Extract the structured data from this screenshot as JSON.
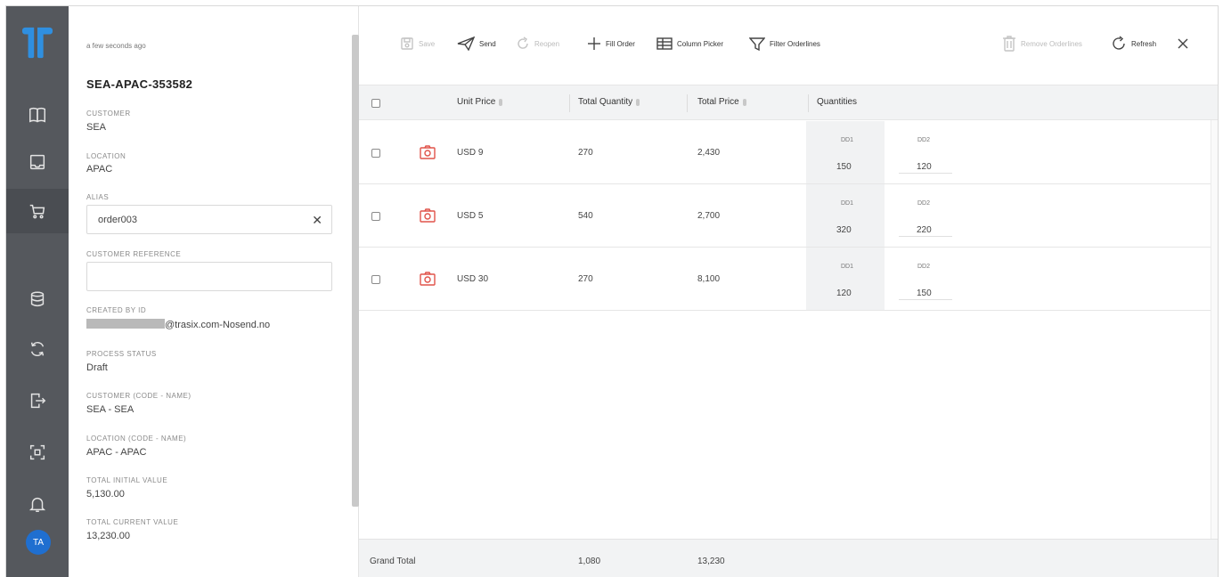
{
  "sidebar": {
    "avatar_initials": "TA",
    "nav": [
      "book-icon",
      "inbox-icon",
      "cart-icon",
      "database-icon",
      "sync-icon",
      "export-icon",
      "scan-icon",
      "bell-icon"
    ],
    "accent": "#1f6fd0"
  },
  "details": {
    "timestamp": "a few seconds ago",
    "order_title": "SEA-APAC-353582",
    "customer_label": "CUSTOMER",
    "customer_value": "SEA",
    "location_label": "LOCATION",
    "location_value": "APAC",
    "alias_label": "ALIAS",
    "alias_value": "order003",
    "customer_reference_label": "CUSTOMER REFERENCE",
    "customer_reference_value": "",
    "created_by_label": "CREATED BY ID",
    "created_by_value": "@trasix.com-Nosend.no",
    "process_status_label": "PROCESS STATUS",
    "process_status_value": "Draft",
    "customer_code_label": "CUSTOMER (CODE - NAME)",
    "customer_code_value": "SEA - SEA",
    "location_code_label": "LOCATION (CODE - NAME)",
    "location_code_value": "APAC - APAC",
    "total_initial_label": "TOTAL INITIAL VALUE",
    "total_initial_value": "5,130.00",
    "total_current_label": "TOTAL CURRENT VALUE",
    "total_current_value": "13,230.00"
  },
  "toolbar": {
    "save": "Save",
    "send": "Send",
    "reopen": "Reopen",
    "fill_order": "Fill Order",
    "column_picker": "Column Picker",
    "filter_orderlines": "Filter Orderlines",
    "remove_orderlines": "Remove Orderlines",
    "refresh": "Refresh"
  },
  "table": {
    "headers": {
      "unit_price": "Unit Price",
      "total_quantity": "Total Quantity",
      "total_price": "Total Price",
      "quantities": "Quantities"
    },
    "rows": [
      {
        "unit_price": "USD 9",
        "total_quantity": "270",
        "total_price": "2,430",
        "dd1_label": "DD1",
        "dd1_value": "150",
        "dd2_label": "DD2",
        "dd2_value": "120"
      },
      {
        "unit_price": "USD 5",
        "total_quantity": "540",
        "total_price": "2,700",
        "dd1_label": "DD1",
        "dd1_value": "320",
        "dd2_label": "DD2",
        "dd2_value": "220"
      },
      {
        "unit_price": "USD 30",
        "total_quantity": "270",
        "total_price": "8,100",
        "dd1_label": "DD1",
        "dd1_value": "120",
        "dd2_label": "DD2",
        "dd2_value": "150"
      }
    ],
    "footer": {
      "label": "Grand Total",
      "total_quantity": "1,080",
      "total_price": "13,230"
    }
  }
}
